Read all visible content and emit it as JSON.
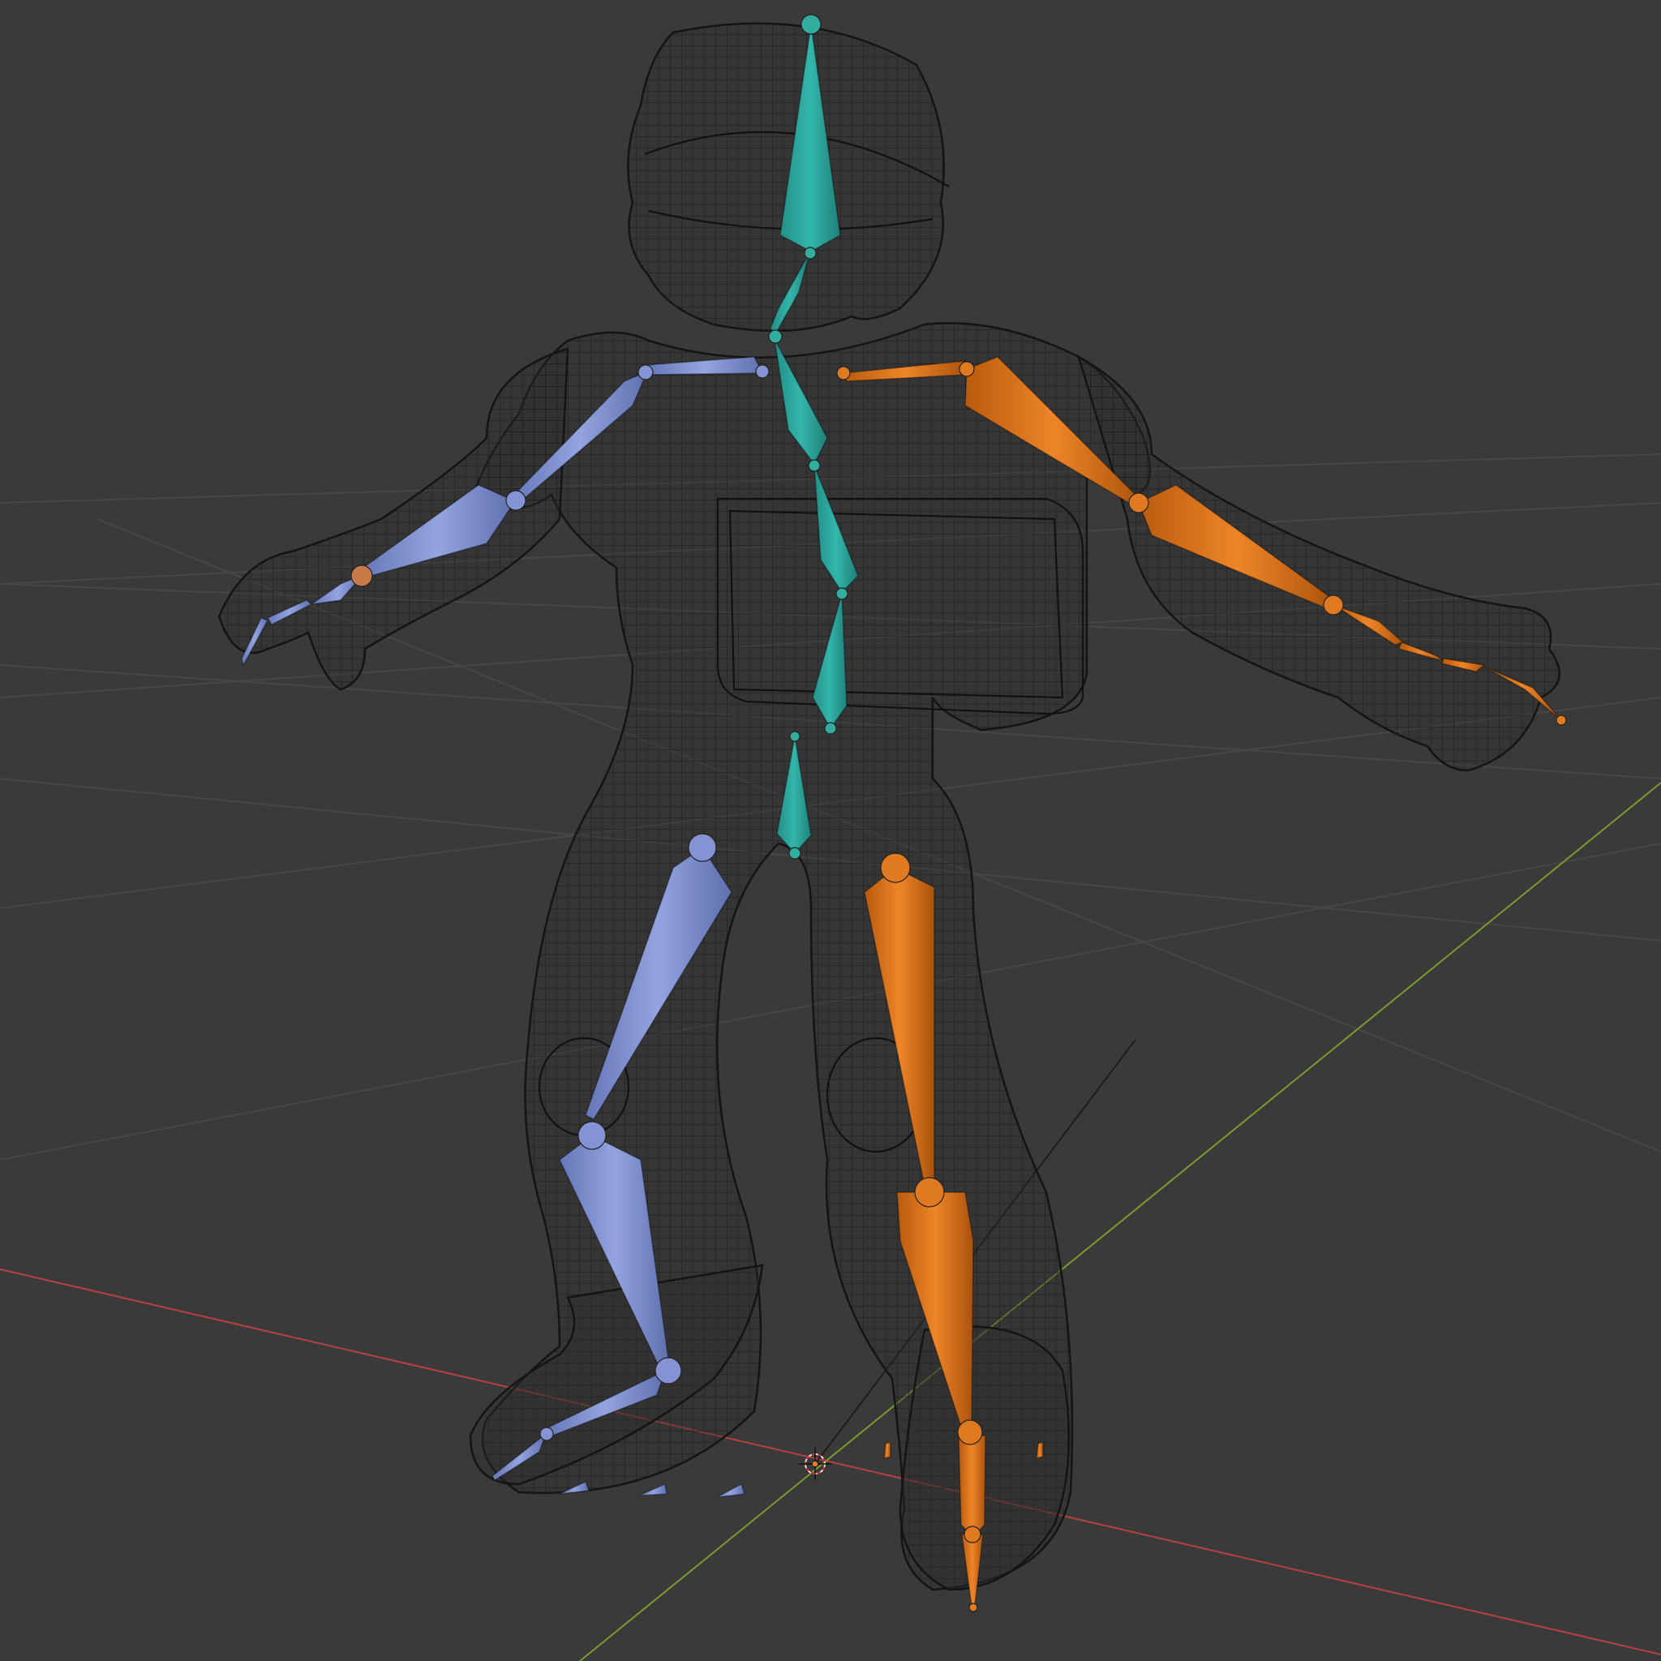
{
  "viewport": {
    "colors": {
      "background": "#3a3a3a",
      "grid": "#474747",
      "x_axis": "#b84040",
      "y_axis": "#7a9a2e",
      "spine_bones": "#2aa39a",
      "left_bones": "#7c8fd0",
      "right_bones": "#de7418",
      "wireframe": "#111111"
    },
    "objects": {
      "mesh": "character-wireframe-mesh",
      "armature": "armature-skeleton",
      "cursor": "3d-cursor-icon"
    }
  }
}
